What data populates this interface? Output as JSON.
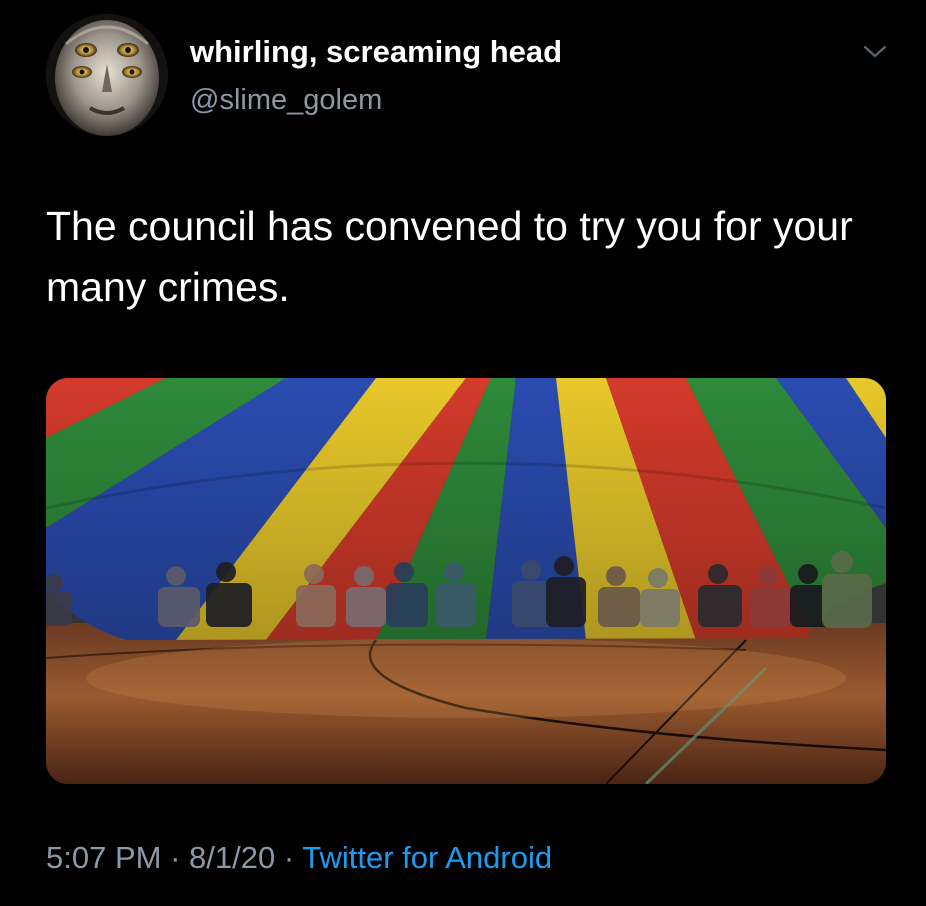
{
  "tweet": {
    "display_name": "whirling, screaming head",
    "handle": "@slime_golem",
    "text": "The council has convened to try you for your many crimes.",
    "time": "5:07 PM",
    "separator": "·",
    "date": "8/1/20",
    "source": "Twitter for Android"
  },
  "icons": {
    "avatar": "alien-face-avatar",
    "menu": "chevron-down-icon"
  },
  "colors": {
    "background": "#000000",
    "name": "#ffffff",
    "secondary": "#8b98a5",
    "link": "#1d9bf0"
  }
}
